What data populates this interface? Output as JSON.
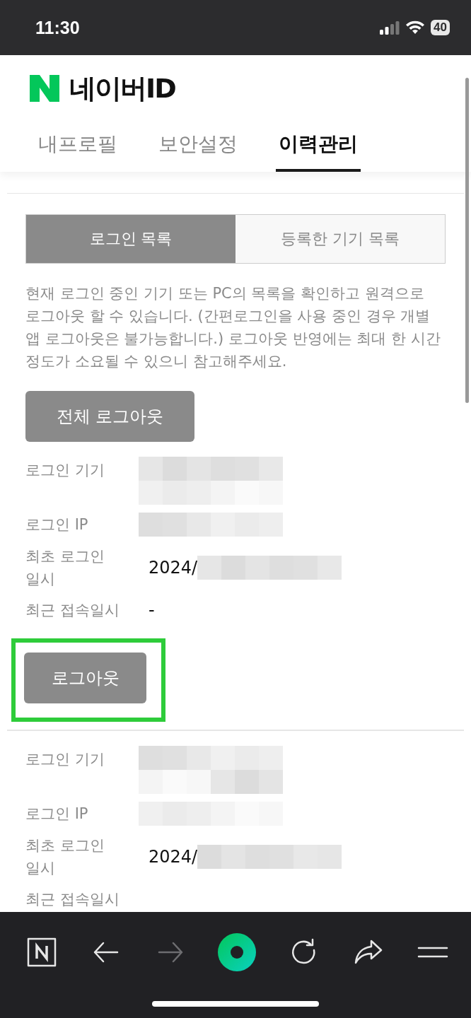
{
  "status_bar": {
    "time": "11:30",
    "battery": "40"
  },
  "header": {
    "logo_text": "네이버ID",
    "tabs": [
      {
        "label": "내프로필",
        "selected": false
      },
      {
        "label": "보안설정",
        "selected": false
      },
      {
        "label": "이력관리",
        "selected": true
      }
    ]
  },
  "segments": [
    {
      "label": "로그인 목록",
      "selected": true
    },
    {
      "label": "등록한 기기 목록",
      "selected": false
    }
  ],
  "description": "현재 로그인 중인 기기 또는 PC의 목록을 확인하고 원격으로 로그아웃 할 수 있습니다. (간편로그인을 사용 중인 경우 개별 앱 로그아웃은 불가능합니다.) 로그아웃 반영에는 최대 한 시간 정도가 소요될 수 있으니 참고해주세요.",
  "logout_all_button": "전체 로그아웃",
  "sessions": [
    {
      "highlighted": true,
      "logout_button": "로그아웃",
      "fields": [
        {
          "label": "로그인 기기",
          "kind": "redacted"
        },
        {
          "label": "로그인 IP",
          "kind": "redacted"
        },
        {
          "label": "최초 로그인 일시",
          "kind": "partial",
          "value": "2024/"
        },
        {
          "label": "최근 접속일시",
          "kind": "text",
          "value": "-"
        }
      ]
    },
    {
      "fields": [
        {
          "label": "로그인 기기",
          "kind": "redacted"
        },
        {
          "label": "로그인 IP",
          "kind": "redacted"
        },
        {
          "label": "최초 로그인 일시",
          "kind": "partial",
          "value": "2024/"
        },
        {
          "label": "최근 접속일시",
          "kind": "text"
        }
      ]
    }
  ],
  "toolbar": {
    "forward_disabled": true
  }
}
